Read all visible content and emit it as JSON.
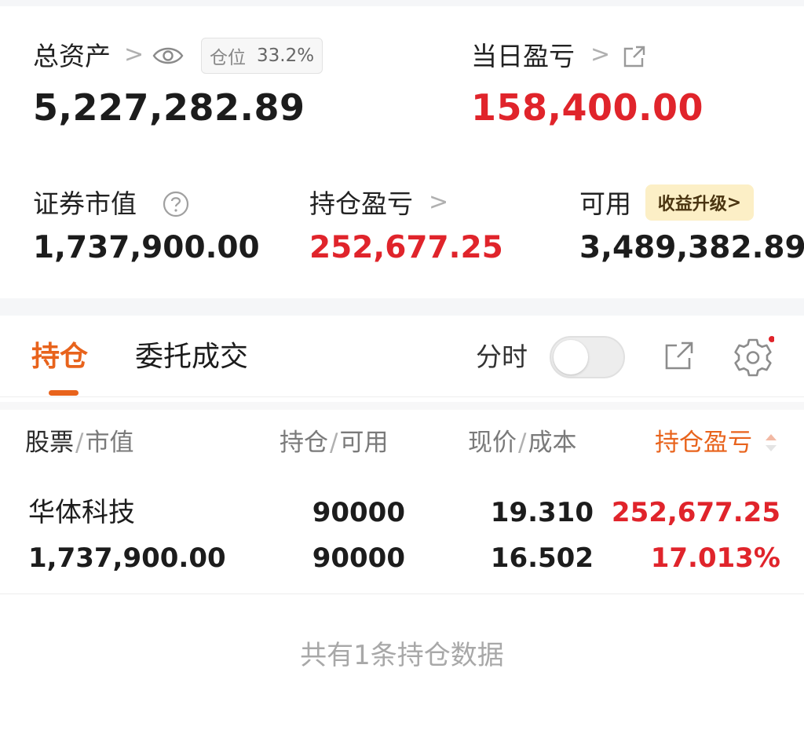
{
  "summary": {
    "total_assets_label": "总资产",
    "total_assets_value": "5,227,282.89",
    "position_label": "仓位",
    "position_value": "33.2%",
    "daily_pnl_label": "当日盈亏",
    "daily_pnl_value": "158,400.00",
    "securities_value_label": "证券市值",
    "securities_value": "1,737,900.00",
    "holding_pnl_label": "持仓盈亏",
    "holding_pnl_value": "252,677.25",
    "available_label": "可用",
    "available_value": "3,489,382.89",
    "upgrade_badge": "收益升级",
    "chevron": ">"
  },
  "tabs": {
    "holdings": "持仓",
    "orders": "委托成交",
    "intraday_label": "分时",
    "intraday_on": false
  },
  "table": {
    "headers": {
      "stock": "股票",
      "market_value": "市值",
      "holding": "持仓",
      "available": "可用",
      "price": "现价",
      "cost": "成本",
      "pnl": "持仓盈亏",
      "slash": "/"
    },
    "rows": [
      {
        "name": "华体科技",
        "market_value": "1,737,900.00",
        "holding": "90000",
        "available": "90000",
        "price": "19.310",
        "cost": "16.502",
        "pnl": "252,677.25",
        "pnl_pct": "17.013%"
      }
    ],
    "footer": "共有1条持仓数据"
  },
  "colors": {
    "accent": "#e8631c",
    "profit": "#e0242b",
    "badge_bg": "#fcefc6"
  },
  "icons": [
    "chevron-right-icon",
    "eye-icon",
    "share-icon",
    "help-icon",
    "external-link-icon",
    "gear-icon",
    "sort-icon"
  ]
}
